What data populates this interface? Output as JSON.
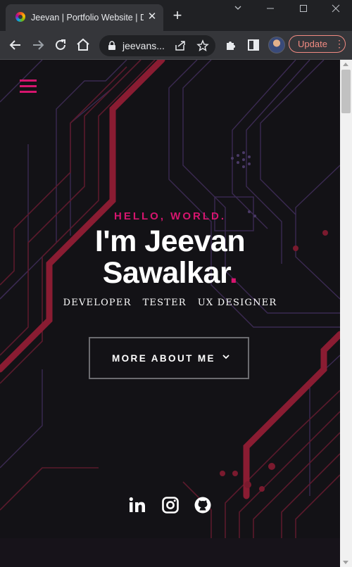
{
  "browser": {
    "tab_title": "Jeevan | Portfolio Website | De",
    "url": "jeevans...",
    "update_label": "Update"
  },
  "icons": {
    "tab": [
      "favicon",
      "close-icon",
      "new-tab-icon"
    ],
    "window": [
      "minimize-icon",
      "restore-icon",
      "close-window-icon",
      "tab-search-icon"
    ],
    "toolbar": [
      "back-icon",
      "forward-icon",
      "reload-icon",
      "home-icon",
      "lock-icon",
      "share-icon",
      "star-icon",
      "extensions-icon",
      "side-panel-icon",
      "profile-avatar",
      "menu-dots-icon"
    ],
    "page": [
      "hamburger-icon",
      "chevron-down-icon",
      "linkedin-icon",
      "instagram-icon",
      "github-icon"
    ]
  },
  "hero": {
    "greeting": "HELLO, WORLD.",
    "name_line1": "I'm Jeevan",
    "name_line2": "Sawalkar",
    "name_period": ".",
    "roles": [
      "DEVELOPER",
      "TESTER",
      "UX DESIGNER"
    ],
    "cta_label": "MORE ABOUT ME"
  },
  "colors": {
    "accent": "#d6156e",
    "page_background": "#131216",
    "text": "#ffffff",
    "button_border": "#6b6b6f",
    "browser_frame": "#202124",
    "update_accent": "#f28b82"
  }
}
